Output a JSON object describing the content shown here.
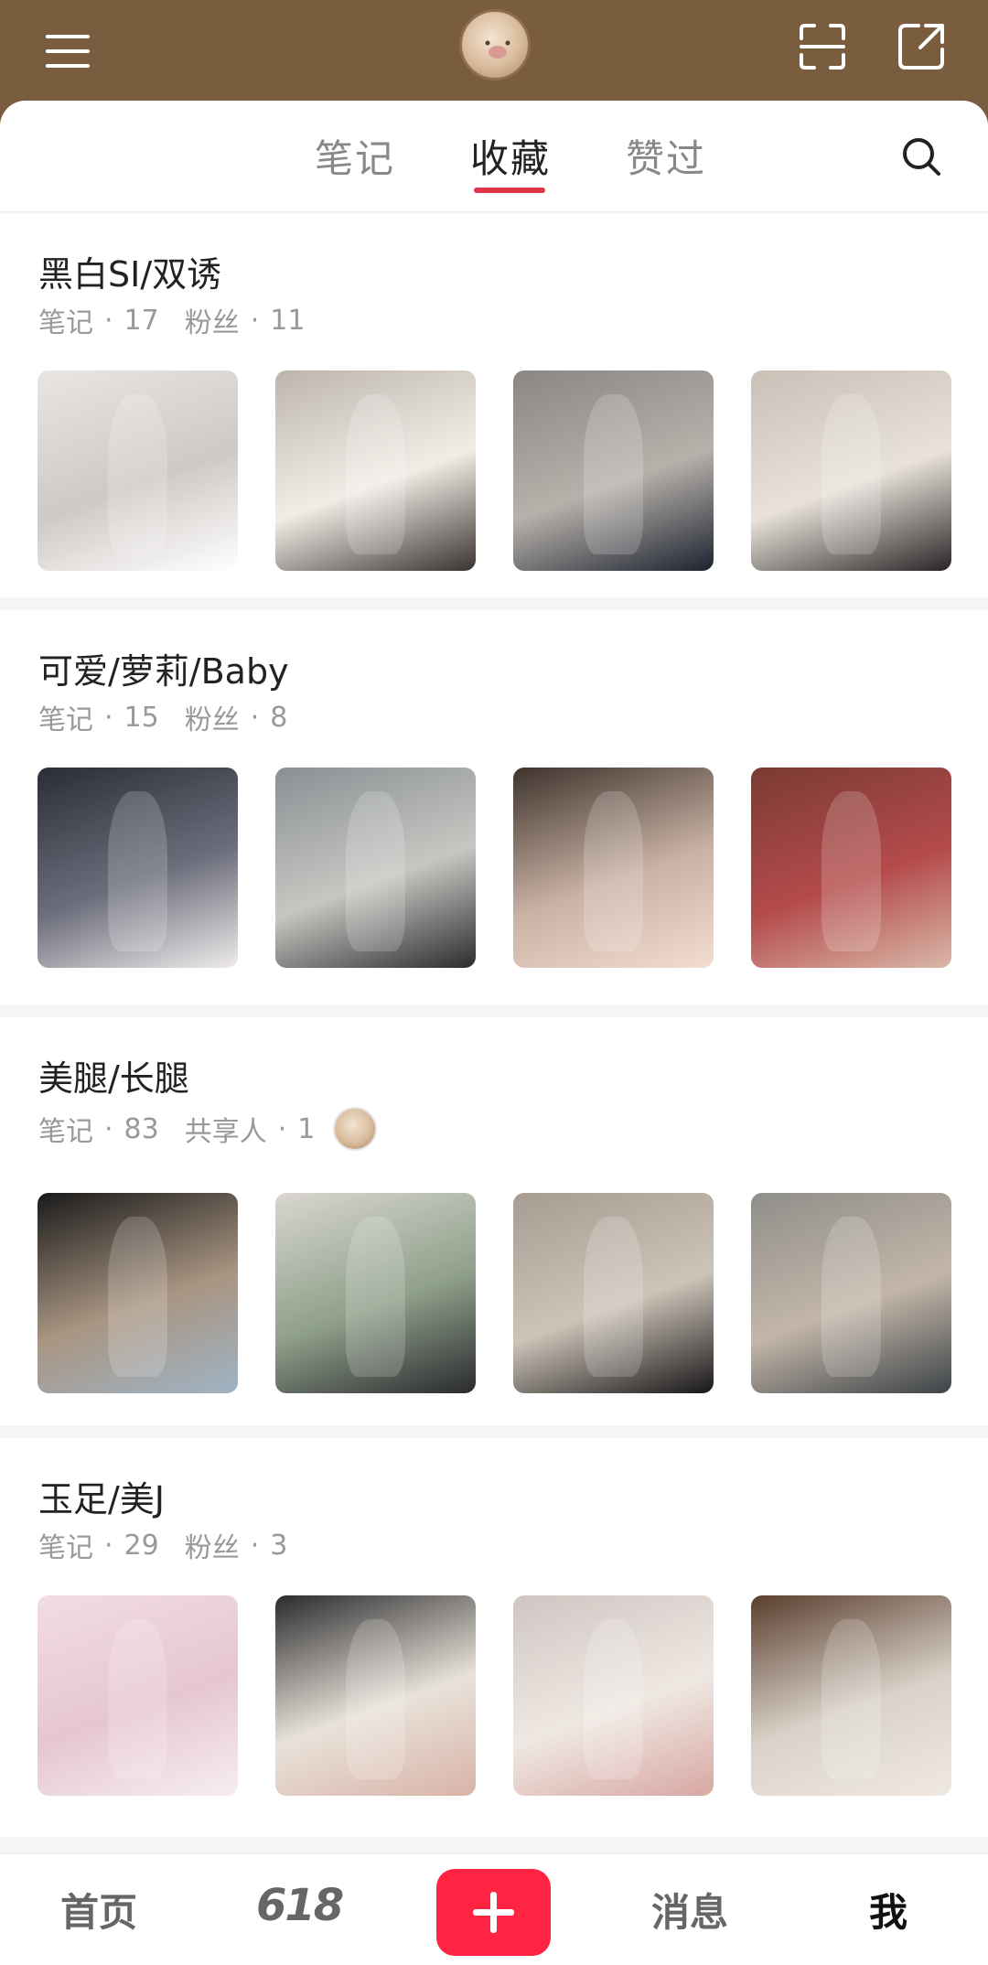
{
  "header": {
    "menu_icon": "menu-icon",
    "scan_icon": "scan-icon",
    "share_icon": "share-icon"
  },
  "tabs": [
    {
      "label": "笔记",
      "active": false
    },
    {
      "label": "收藏",
      "active": true
    },
    {
      "label": "赞过",
      "active": false
    }
  ],
  "accent_color": "#e0344a",
  "boards": [
    {
      "title": "黑白SI/双诱",
      "notes_label": "笔记",
      "notes_count": "17",
      "second_label": "粉丝",
      "second_count": "11",
      "shared": false,
      "thumbs": [
        {
          "colors": [
            "#e9e5e3",
            "#cfc9c6",
            "#ffffff"
          ]
        },
        {
          "colors": [
            "#bcb5ae",
            "#f1ede6",
            "#3a3330"
          ]
        },
        {
          "colors": [
            "#8a8683",
            "#b7b1ab",
            "#1d2330"
          ]
        },
        {
          "colors": [
            "#c9c0b6",
            "#e8e2da",
            "#2a2526"
          ]
        }
      ]
    },
    {
      "title": "可爱/萝莉/Baby",
      "notes_label": "笔记",
      "notes_count": "15",
      "second_label": "粉丝",
      "second_count": "8",
      "shared": false,
      "thumbs": [
        {
          "colors": [
            "#2a2c36",
            "#6c6e7c",
            "#f0ecec"
          ]
        },
        {
          "colors": [
            "#8a8f93",
            "#c6c7c2",
            "#2e2b2f"
          ]
        },
        {
          "colors": [
            "#3e332c",
            "#c9b2a4",
            "#f3ddd0"
          ]
        },
        {
          "colors": [
            "#7a3a33",
            "#b44b4b",
            "#d9b7a8"
          ]
        }
      ]
    },
    {
      "title": "美腿/长腿",
      "notes_label": "笔记",
      "notes_count": "83",
      "second_label": "共享人",
      "second_count": "1",
      "shared": true,
      "thumbs": [
        {
          "colors": [
            "#1a1a1a",
            "#a99582",
            "#9fb3c4"
          ]
        },
        {
          "colors": [
            "#d9d6d0",
            "#8fa08a",
            "#2a2a2e"
          ]
        },
        {
          "colors": [
            "#a69c91",
            "#cdc4b8",
            "#181618"
          ]
        },
        {
          "colors": [
            "#8f8e8a",
            "#c3b6a9",
            "#3d4347"
          ]
        }
      ]
    },
    {
      "title": "玉足/美J",
      "notes_label": "笔记",
      "notes_count": "29",
      "second_label": "粉丝",
      "second_count": "3",
      "shared": false,
      "thumbs": [
        {
          "colors": [
            "#f1dde2",
            "#e6c6cf",
            "#f6eef0"
          ]
        },
        {
          "colors": [
            "#2b2b2d",
            "#e8e2d9",
            "#d9b3a8"
          ]
        },
        {
          "colors": [
            "#cfc6c2",
            "#efe8e2",
            "#d8a7a3"
          ]
        },
        {
          "colors": [
            "#5a3e2e",
            "#d9d2c8",
            "#efe9e2"
          ]
        }
      ]
    }
  ],
  "bottom_nav": [
    {
      "label": "首页",
      "active": false
    },
    {
      "label": "618",
      "active": false
    },
    {
      "label": "消息",
      "active": false
    },
    {
      "label": "我",
      "active": true
    }
  ],
  "publish_color": "#ff2442"
}
